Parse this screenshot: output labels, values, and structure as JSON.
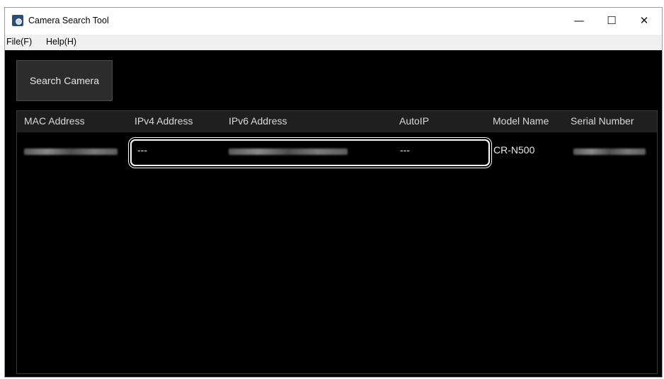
{
  "window": {
    "title": "Camera Search Tool",
    "controls": {
      "minimize": "—",
      "maximize": "☐",
      "close": "✕"
    }
  },
  "menu": {
    "file": "File(F)",
    "help": "Help(H)"
  },
  "toolbar": {
    "search_label": "Search Camera"
  },
  "table": {
    "columns": [
      "MAC Address",
      "IPv4 Address",
      "IPv6 Address",
      "AutoIP",
      "Model Name",
      "Serial Number"
    ],
    "rows": [
      {
        "mac": "",
        "ipv4": "---",
        "ipv6": "",
        "autoip": "---",
        "model": "CR-N500",
        "serial": ""
      }
    ]
  },
  "colors": {
    "background": "#000000",
    "header": "#1f1f1f",
    "highlight": "#ffffff"
  }
}
